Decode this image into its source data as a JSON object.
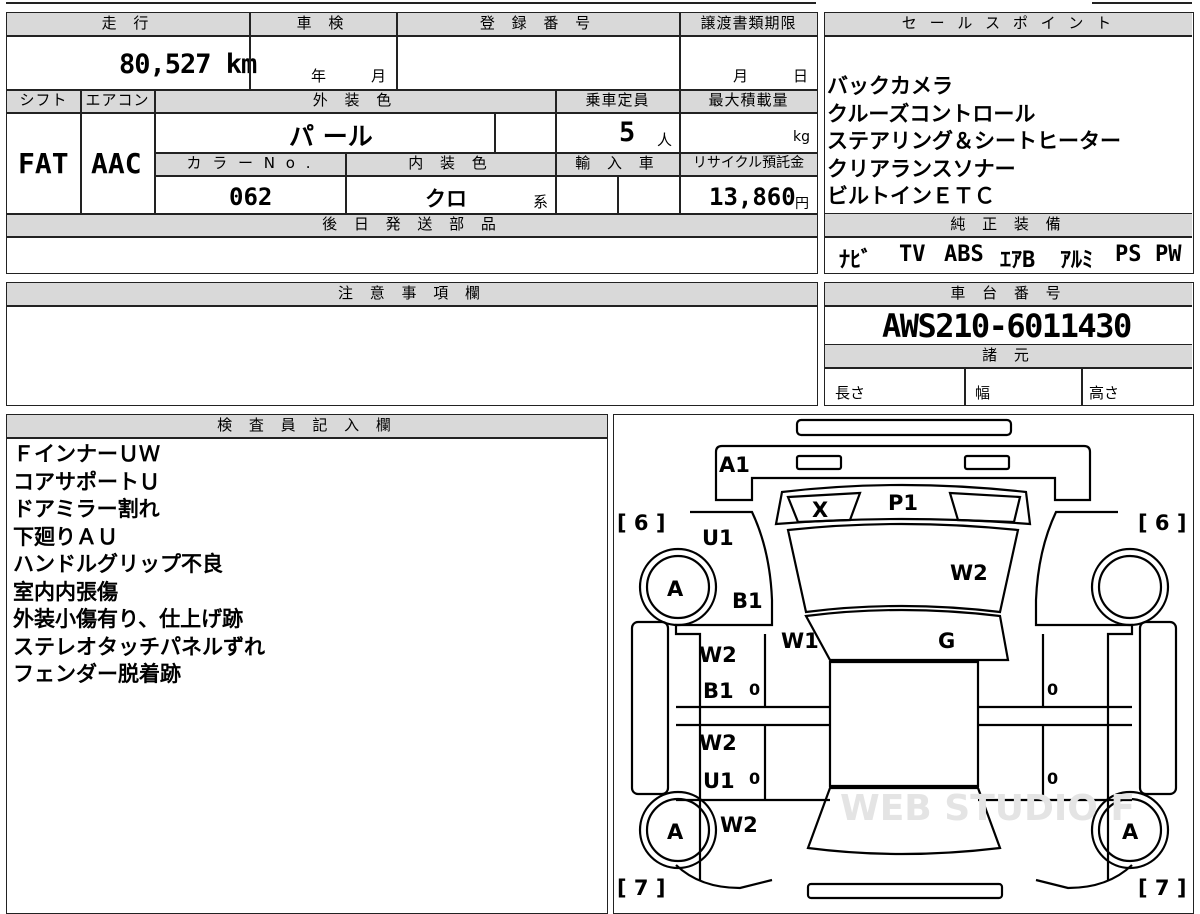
{
  "top_table": {
    "mileage_header": "走 行",
    "mileage_value": "80,527 km",
    "inspection_header": "車 検",
    "inspection_year": "年",
    "inspection_month": "月",
    "registration_header": "登 録 番 号",
    "transfer_header": "譲渡書類期限",
    "transfer_month": "月",
    "transfer_day": "日",
    "shift_header": "シフト",
    "shift_value": "FAT",
    "aircon_header": "エアコン",
    "aircon_value": "AAC",
    "exterior_color_header": "外 装 色",
    "exterior_color_value": "パ ール",
    "capacity_header": "乗車定員",
    "capacity_value": "5",
    "capacity_unit": "人",
    "max_load_header": "最大積載量",
    "max_load_unit": "kg",
    "color_no_header": "カ ラ ー N o .",
    "color_no_value": "062",
    "interior_color_header": "内 装 色",
    "interior_color_value": "クロ",
    "interior_color_suffix": "系",
    "import_header": "輸 入 車",
    "recycle_header": "リサイクル預託金",
    "recycle_value": "13,860",
    "recycle_unit": "円",
    "later_parts_header": "後 日 発 送 部 品"
  },
  "sales_points": {
    "header": "セ ー ル ス ポ イ ン ト",
    "items": [
      "バックカメラ",
      "クルーズコントロール",
      "ステアリング＆シートヒーター",
      "クリアランスソナー",
      "ビルトインＥＴＣ"
    ]
  },
  "genuine_equipment": {
    "header": "純 正 装 備",
    "items": [
      "ﾅﾋﾞ",
      "TV",
      "ABS",
      "ｴｱB",
      "ｱﾙﾐ",
      "PS",
      "PW"
    ]
  },
  "notes": {
    "header": "注 意 事 項 欄"
  },
  "chassis": {
    "header": "車 台 番 号",
    "value": "AWS210-6011430",
    "specs_header": "諸 元",
    "length_label": "長さ",
    "width_label": "幅",
    "height_label": "高さ"
  },
  "inspector": {
    "header": "検 査 員 記 入 欄",
    "items": [
      "ＦインナーＵＷ",
      "コアサポートＵ",
      "ドアミラー割れ",
      "下廻りＡＵ",
      "ハンドルグリップ不良",
      "室内内張傷",
      "外装小傷有り、仕上げ跡",
      "ステレオタッチパネルずれ",
      "フェンダー脱着跡"
    ]
  },
  "diagram": {
    "marks": {
      "a1": "A1",
      "x": "X",
      "p1": "P1",
      "u1_top": "U1",
      "w2_roof": "W2",
      "b1_pillar": "B1",
      "w1": "W1",
      "g": "G",
      "w2_front_door": "W2",
      "b1_front_door": "B1",
      "w2_rear_door": "W2",
      "u1_rear_door": "U1",
      "w2_rear": "W2",
      "a_front_left": "A",
      "a_rear_left": "A",
      "a_rear_right": "A",
      "zero_1": "0",
      "zero_2": "0",
      "zero_3": "0",
      "zero_4": "0"
    },
    "tire_labels": {
      "front_left": "[ 6 ]",
      "front_right": "[ 6 ]",
      "rear_left": "[ 7 ]",
      "rear_right": "[ 7 ]"
    },
    "watermark": "WEB STUDIO F"
  }
}
